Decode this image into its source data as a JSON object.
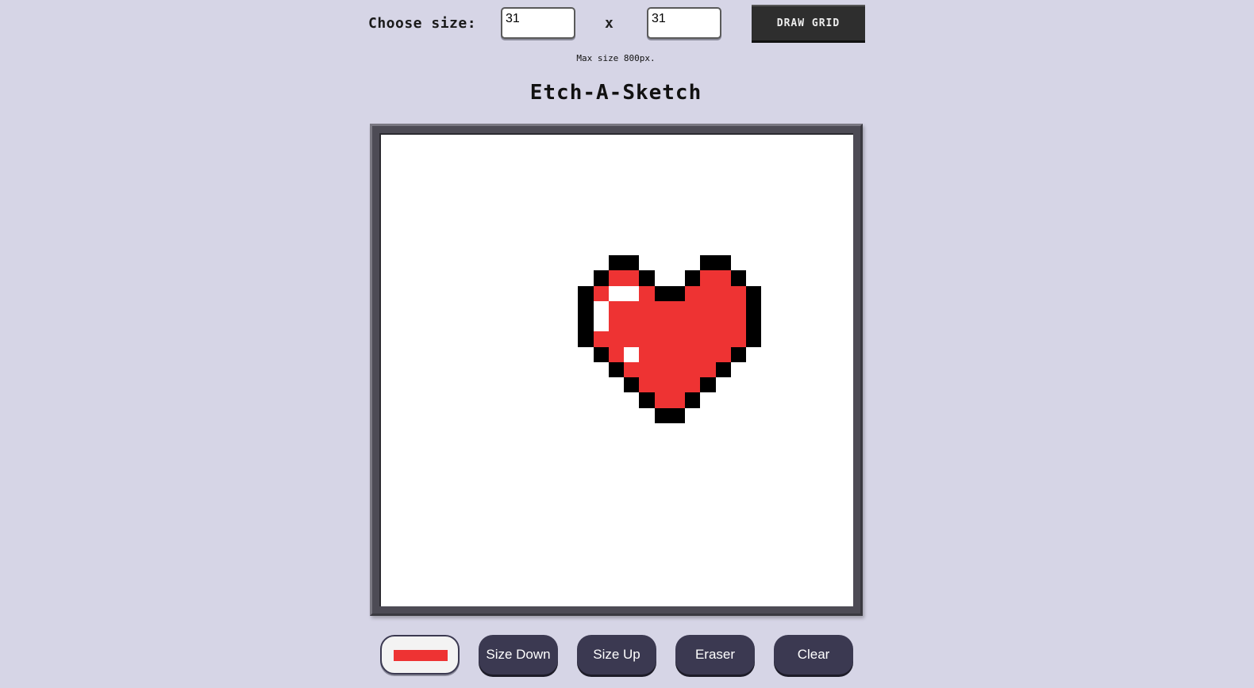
{
  "size_form": {
    "label": "Choose size:",
    "width_value": "31",
    "height_value": "31",
    "separator": "x",
    "draw_button": "DRAW GRID",
    "note": "Max size 800px."
  },
  "title": "Etch-A-Sketch",
  "grid": {
    "columns": 31,
    "rows": 31,
    "colors": {
      "k": "#000000",
      "r": "#ee3333",
      "w": "#ffffff"
    },
    "pixels": [
      "...............................",
      "...............................",
      "...............................",
      "...............................",
      "...............................",
      "...............................",
      "...............................",
      "...............................",
      "...............kk....kk........",
      "..............krrk..krrk.......",
      ".............krwwrkkrrrrk......",
      ".............kwrrrrrrrrrk......",
      ".............kwrrrrrrrrrk......",
      ".............krrrrrrrrrrk......",
      "..............krwrrrrrrk.......",
      "...............krrrrrrk........",
      "................krrrrk.........",
      ".................krrk..........",
      "..................kk...........",
      "...............................",
      "...............................",
      "...............................",
      "...............................",
      "...............................",
      "...............................",
      "...............................",
      "...............................",
      "...............................",
      "...............................",
      "...............................",
      "..............................."
    ]
  },
  "controls": {
    "color_value": "#ee3333",
    "size_down": "Size Down",
    "size_up": "Size Up",
    "eraser": "Eraser",
    "clear": "Clear"
  }
}
